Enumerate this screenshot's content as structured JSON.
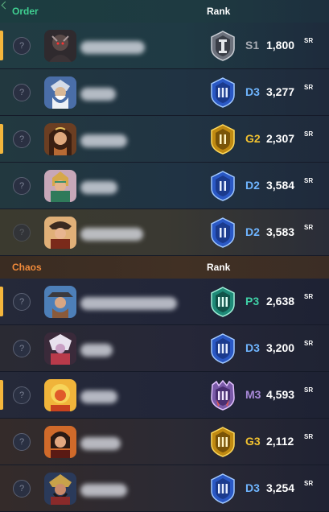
{
  "order": {
    "team_label": "Order",
    "rank_label": "Rank",
    "players": [
      {
        "tier": "S1",
        "sr": "1,800",
        "sr_unit": "SR",
        "tier_color": "#a8acb4",
        "emblem": "silver-rank-emblem",
        "party_marker": "?",
        "highlight": true
      },
      {
        "tier": "D3",
        "sr": "3,277",
        "sr_unit": "SR",
        "tier_color": "#6fb5ff",
        "emblem": "diamond-rank-emblem",
        "party_marker": "?",
        "highlight": false
      },
      {
        "tier": "G2",
        "sr": "2,307",
        "sr_unit": "SR",
        "tier_color": "#f2c230",
        "emblem": "gold-rank-emblem",
        "party_marker": "?",
        "highlight": true
      },
      {
        "tier": "D2",
        "sr": "3,584",
        "sr_unit": "SR",
        "tier_color": "#6fb5ff",
        "emblem": "diamond-rank-emblem",
        "party_marker": "?",
        "highlight": false
      },
      {
        "tier": "D2",
        "sr": "3,583",
        "sr_unit": "SR",
        "tier_color": "#6fb5ff",
        "emblem": "diamond-rank-emblem",
        "party_marker": "?",
        "highlight": false
      }
    ]
  },
  "chaos": {
    "team_label": "Chaos",
    "rank_label": "Rank",
    "players": [
      {
        "tier": "P3",
        "sr": "2,638",
        "sr_unit": "SR",
        "tier_color": "#3fd0a6",
        "emblem": "platinum-rank-emblem",
        "party_marker": "?",
        "highlight": true
      },
      {
        "tier": "D3",
        "sr": "3,200",
        "sr_unit": "SR",
        "tier_color": "#6fb5ff",
        "emblem": "diamond-rank-emblem",
        "party_marker": "?",
        "highlight": false
      },
      {
        "tier": "M3",
        "sr": "4,593",
        "sr_unit": "SR",
        "tier_color": "#a889d8",
        "emblem": "masters-rank-emblem",
        "party_marker": "?",
        "highlight": true
      },
      {
        "tier": "G3",
        "sr": "2,112",
        "sr_unit": "SR",
        "tier_color": "#f2c230",
        "emblem": "gold-rank-emblem",
        "party_marker": "?",
        "highlight": false
      },
      {
        "tier": "D3",
        "sr": "3,254",
        "sr_unit": "SR",
        "tier_color": "#6fb5ff",
        "emblem": "diamond-rank-emblem",
        "party_marker": "?",
        "highlight": false
      }
    ]
  }
}
